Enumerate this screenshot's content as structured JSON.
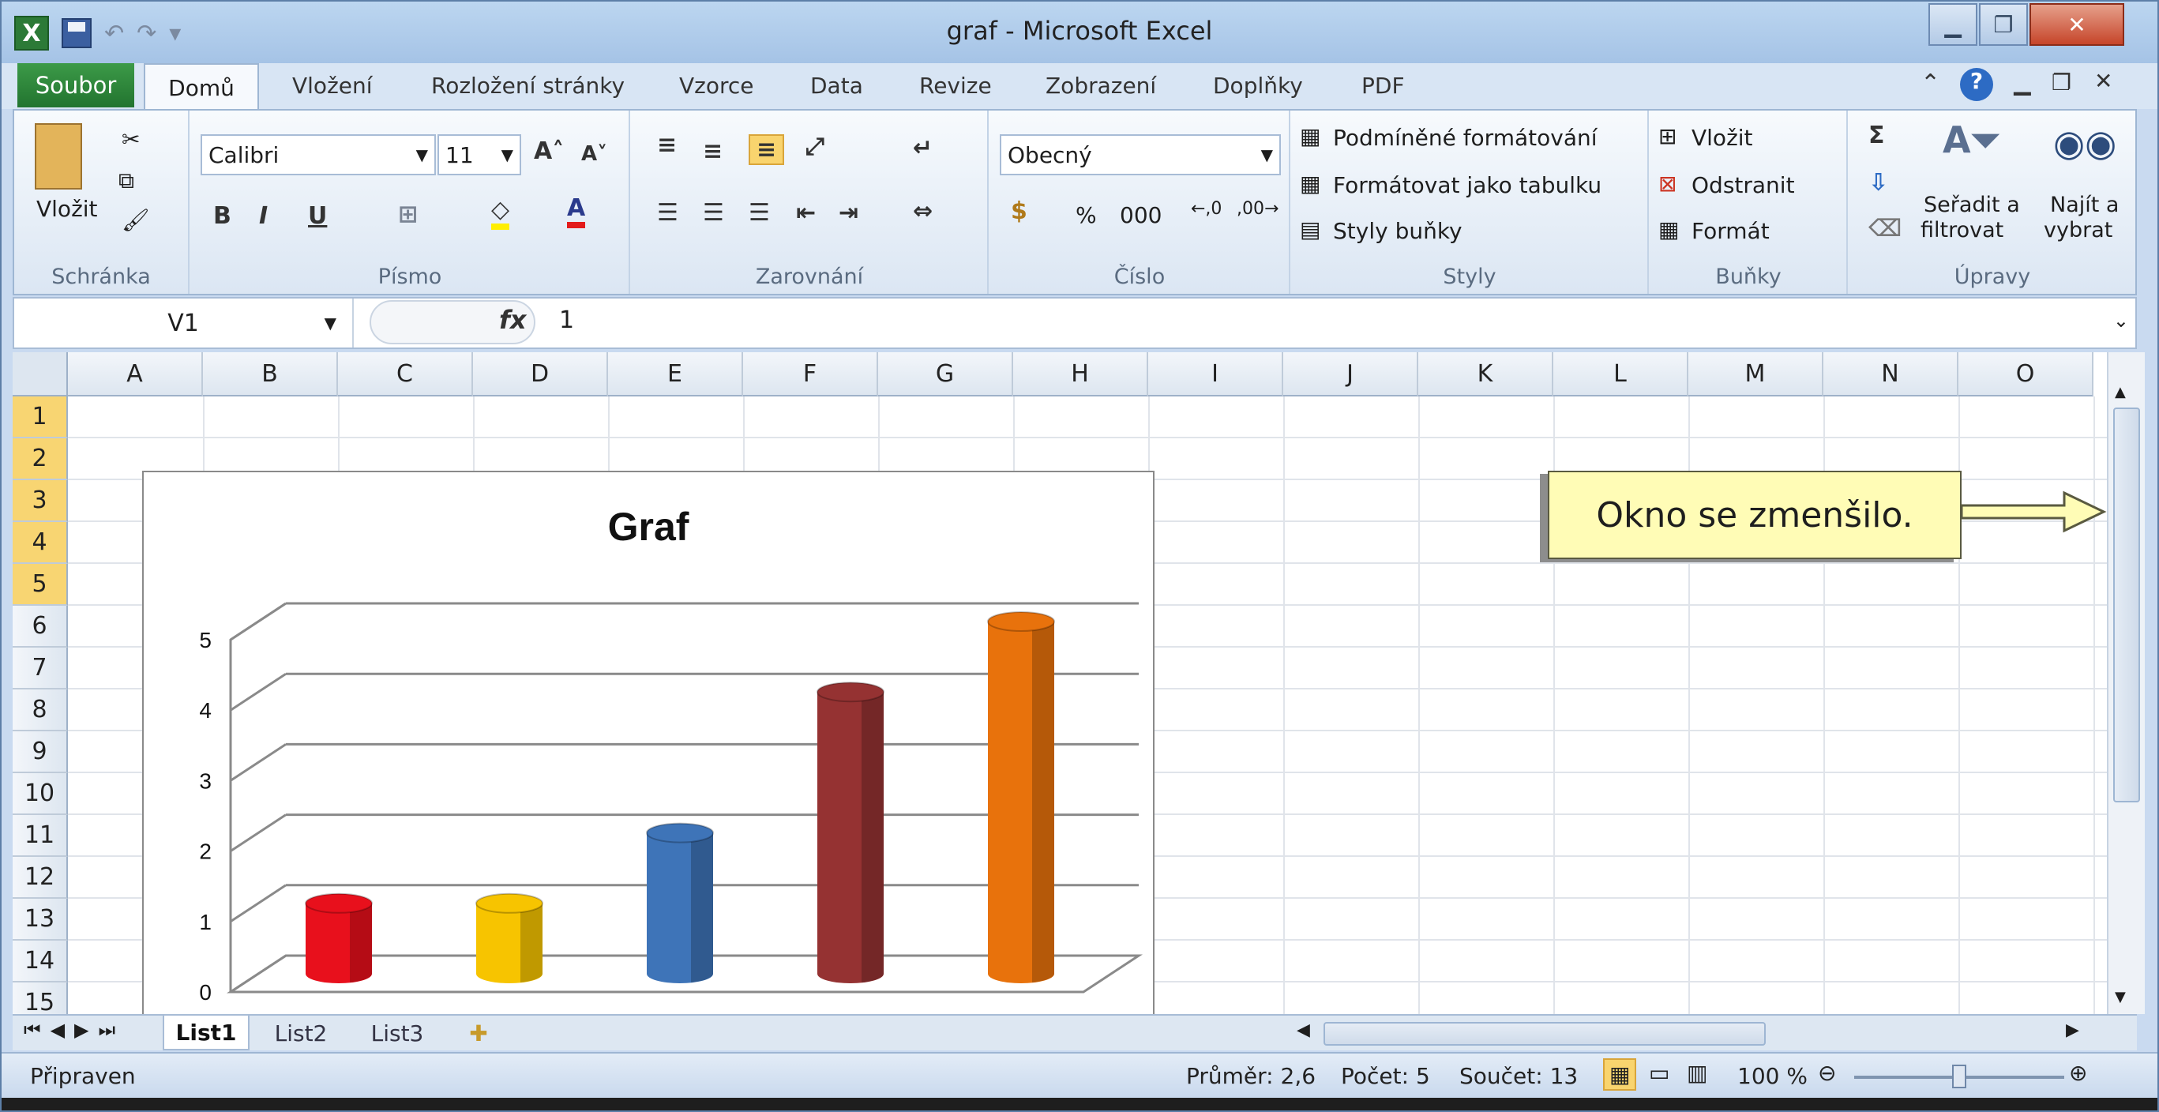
{
  "window": {
    "title": "graf  -  Microsoft Excel",
    "minimize_icon": "minimize-icon",
    "restore_icon": "restore-icon",
    "close_icon": "close-icon"
  },
  "ribbon_tabs": {
    "file": "Soubor",
    "items": [
      "Domů",
      "Vložení",
      "Rozložení stránky",
      "Vzorce",
      "Data",
      "Revize",
      "Zobrazení",
      "Doplňky",
      "PDF"
    ]
  },
  "ribbon": {
    "clipboard": {
      "paste": "Vložit",
      "label": "Schránka"
    },
    "font": {
      "name": "Calibri",
      "size": "11",
      "bold": "B",
      "italic": "I",
      "underline": "U",
      "label": "Písmo"
    },
    "alignment": {
      "label": "Zarovnání"
    },
    "number": {
      "format": "Obecný",
      "percent": "%",
      "thousands": "000",
      "label": "Číslo"
    },
    "styles": {
      "conditional": "Podmíněné formátování",
      "as_table": "Formátovat jako tabulku",
      "cell_styles": "Styly buňky",
      "label": "Styly"
    },
    "cells": {
      "insert": "Vložit",
      "delete": "Odstranit",
      "format": "Formát",
      "label": "Buňky"
    },
    "editing": {
      "sort_line1": "Seřadit a",
      "sort_line2": "filtrovat",
      "find_line1": "Najít a",
      "find_line2": "vybrat",
      "label": "Úpravy"
    }
  },
  "formula_bar": {
    "name_box": "V1",
    "fx": "fx",
    "value": "1"
  },
  "sheet": {
    "columns": [
      "A",
      "B",
      "C",
      "D",
      "E",
      "F",
      "G",
      "H",
      "I",
      "J",
      "K",
      "L",
      "M",
      "N",
      "O"
    ],
    "rows": [
      "1",
      "2",
      "3",
      "4",
      "5",
      "6",
      "7",
      "8",
      "9",
      "10",
      "11",
      "12",
      "13",
      "14",
      "15"
    ],
    "selected_rows": [
      "1",
      "2",
      "3",
      "4",
      "5"
    ]
  },
  "callout": {
    "text": "Okno se zmenšilo."
  },
  "chart_data": {
    "type": "bar",
    "title": "Graf",
    "categories": [
      "",
      "",
      "",
      "",
      ""
    ],
    "values": [
      1,
      1,
      2,
      4,
      5
    ],
    "colors": [
      "#e8101c",
      "#f7c400",
      "#3e74b8",
      "#953232",
      "#e8720c"
    ],
    "ylim": [
      0,
      5
    ],
    "yticks": [
      "0",
      "1",
      "2",
      "3",
      "4",
      "5"
    ],
    "grid": true
  },
  "sheet_tabs": [
    "List1",
    "List2",
    "List3"
  ],
  "status": {
    "ready": "Připraven",
    "average": "Průměr: 2,6",
    "count": "Počet: 5",
    "sum": "Součet: 13",
    "zoom": "100 %"
  }
}
